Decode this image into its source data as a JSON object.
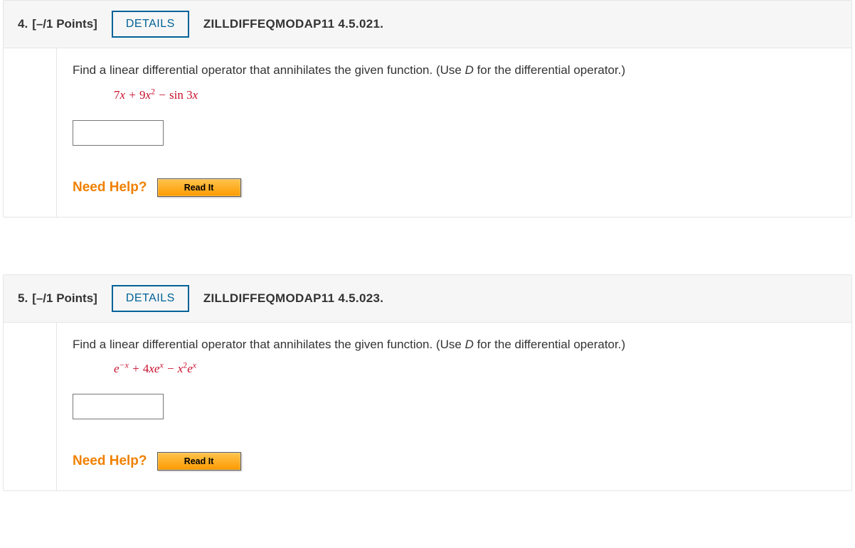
{
  "common": {
    "details_label": "DETAILS",
    "need_help_label": "Need Help?",
    "read_it_label": "Read It"
  },
  "questions": [
    {
      "number": "4.",
      "points": "[–/1 Points]",
      "reference": "ZILLDIFFEQMODAP11 4.5.021.",
      "prompt_prefix": "Find a linear differential operator that annihilates the given function. (Use ",
      "prompt_var": "D",
      "prompt_suffix": " for the differential operator.)",
      "expression_html": "<span class=\"upright\">7</span>x + <span class=\"upright\">9</span>x<sup class=\"upright\">2</sup> − <span class=\"upright\">sin</span> <span class=\"upright\">3</span>x",
      "answer_value": ""
    },
    {
      "number": "5.",
      "points": "[–/1 Points]",
      "reference": "ZILLDIFFEQMODAP11 4.5.023.",
      "prompt_prefix": "Find a linear differential operator that annihilates the given function. (Use ",
      "prompt_var": "D",
      "prompt_suffix": " for the differential operator.)",
      "expression_html": "e<sup>−x</sup> + <span class=\"upright\">4</span>xe<sup>x</sup> − x<sup class=\"upright\">2</sup>e<sup>x</sup>",
      "answer_value": ""
    }
  ]
}
